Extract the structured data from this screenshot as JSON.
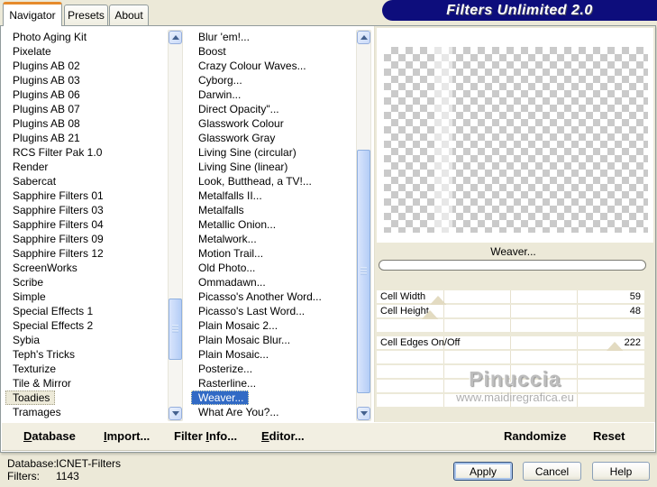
{
  "window_title": "Filters Unlimited 2.0",
  "tabs": {
    "navigator": "Navigator",
    "presets": "Presets",
    "about": "About",
    "active": "Navigator"
  },
  "category_list": {
    "items": [
      "Photo Aging Kit",
      "Pixelate",
      "Plugins AB 02",
      "Plugins AB 03",
      "Plugins AB 06",
      "Plugins AB 07",
      "Plugins AB 08",
      "Plugins AB 21",
      "RCS Filter Pak 1.0",
      "Render",
      "Sabercat",
      "Sapphire Filters 01",
      "Sapphire Filters 03",
      "Sapphire Filters 04",
      "Sapphire Filters 09",
      "Sapphire Filters 12",
      "ScreenWorks",
      "Scribe",
      "Simple",
      "Special Effects 1",
      "Special Effects 2",
      "Sybia",
      "Teph's Tricks",
      "Texturize",
      "Tile & Mirror",
      "Toadies",
      "Tramages"
    ],
    "selected": "Toadies"
  },
  "filter_list": {
    "items": [
      "Blur 'em!...",
      "Boost",
      "Crazy Colour Waves...",
      "Cyborg...",
      "Darwin...",
      "Direct Opacity\"...",
      "Glasswork Colour",
      "Glasswork Gray",
      "Living Sine (circular)",
      "Living Sine (linear)",
      "Look, Butthead, a TV!...",
      "Metalfalls II...",
      "Metalfalls",
      "Metallic Onion...",
      "Metalwork...",
      "Motion Trail...",
      "Old Photo...",
      "Ommadawn...",
      "Picasso's Another Word...",
      "Picasso's Last Word...",
      "Plain Mosaic 2...",
      "Plain Mosaic Blur...",
      "Plain Mosaic...",
      "Posterize...",
      "Rasterline...",
      "Weaver...",
      "What Are You?..."
    ],
    "selected": "Weaver..."
  },
  "preview": {
    "selected_filter": "Weaver...",
    "watermark_title": "Pinuccia",
    "watermark_url": "www.maidiregrafica.eu"
  },
  "sliders": [
    {
      "label": "Cell Width",
      "value": "59",
      "pos_pct": 23
    },
    {
      "label": "Cell Height",
      "value": "48",
      "pos_pct": 20
    },
    {
      "label": "Cell Edges On/Off",
      "value": "222",
      "pos_pct": 89
    }
  ],
  "toolbar": {
    "items": [
      {
        "pre": "",
        "key": "D",
        "post": "atabase"
      },
      {
        "pre": "",
        "key": "I",
        "post": "mport..."
      },
      {
        "pre": "Filter ",
        "key": "I",
        "post": "nfo..."
      },
      {
        "pre": "",
        "key": "E",
        "post": "ditor..."
      }
    ],
    "randomize": "Randomize",
    "reset": "Reset"
  },
  "status": {
    "database_label": "Database:",
    "database_value": "ICNET-Filters",
    "filters_label": "Filters:",
    "filters_value": "1143"
  },
  "actions": {
    "apply": "Apply",
    "cancel": "Cancel",
    "help": "Help"
  },
  "colors": {
    "titlebar_navy": "#0D0D7C",
    "selection_blue": "#316AC5",
    "tab_accent_orange": "#E68B2C",
    "dialog_beige": "#ECE9D8"
  }
}
